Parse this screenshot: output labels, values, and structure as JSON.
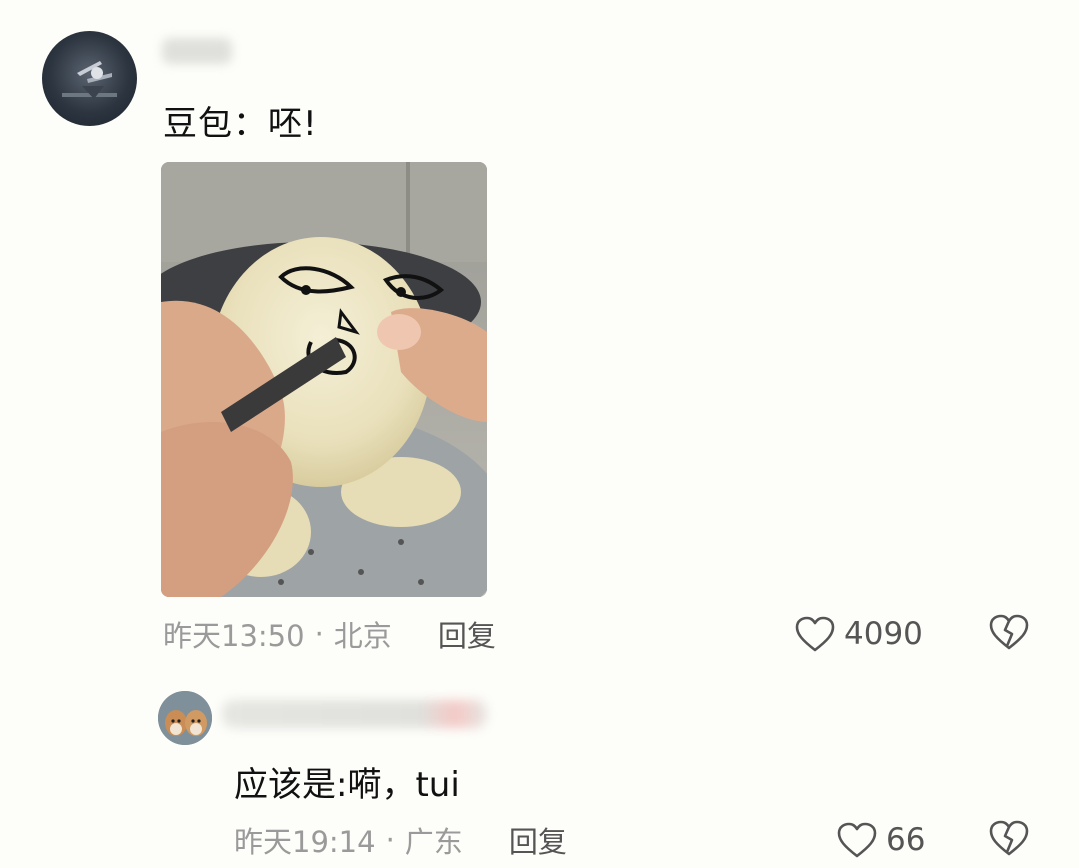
{
  "comment": {
    "text": "豆包：呸!",
    "time": "昨天13:50",
    "separator": "·",
    "location": "北京",
    "reply_label": "回复",
    "likes": "4090",
    "icons": {
      "like": "heart-outline-icon",
      "dislike": "broken-heart-icon"
    }
  },
  "reply": {
    "text": "应该是:嗬，tui",
    "time": "昨天19:14",
    "separator": "·",
    "location": "广东",
    "reply_label": "回复",
    "likes": "66",
    "icons": {
      "like": "heart-outline-icon",
      "dislike": "broken-heart-icon"
    }
  }
}
